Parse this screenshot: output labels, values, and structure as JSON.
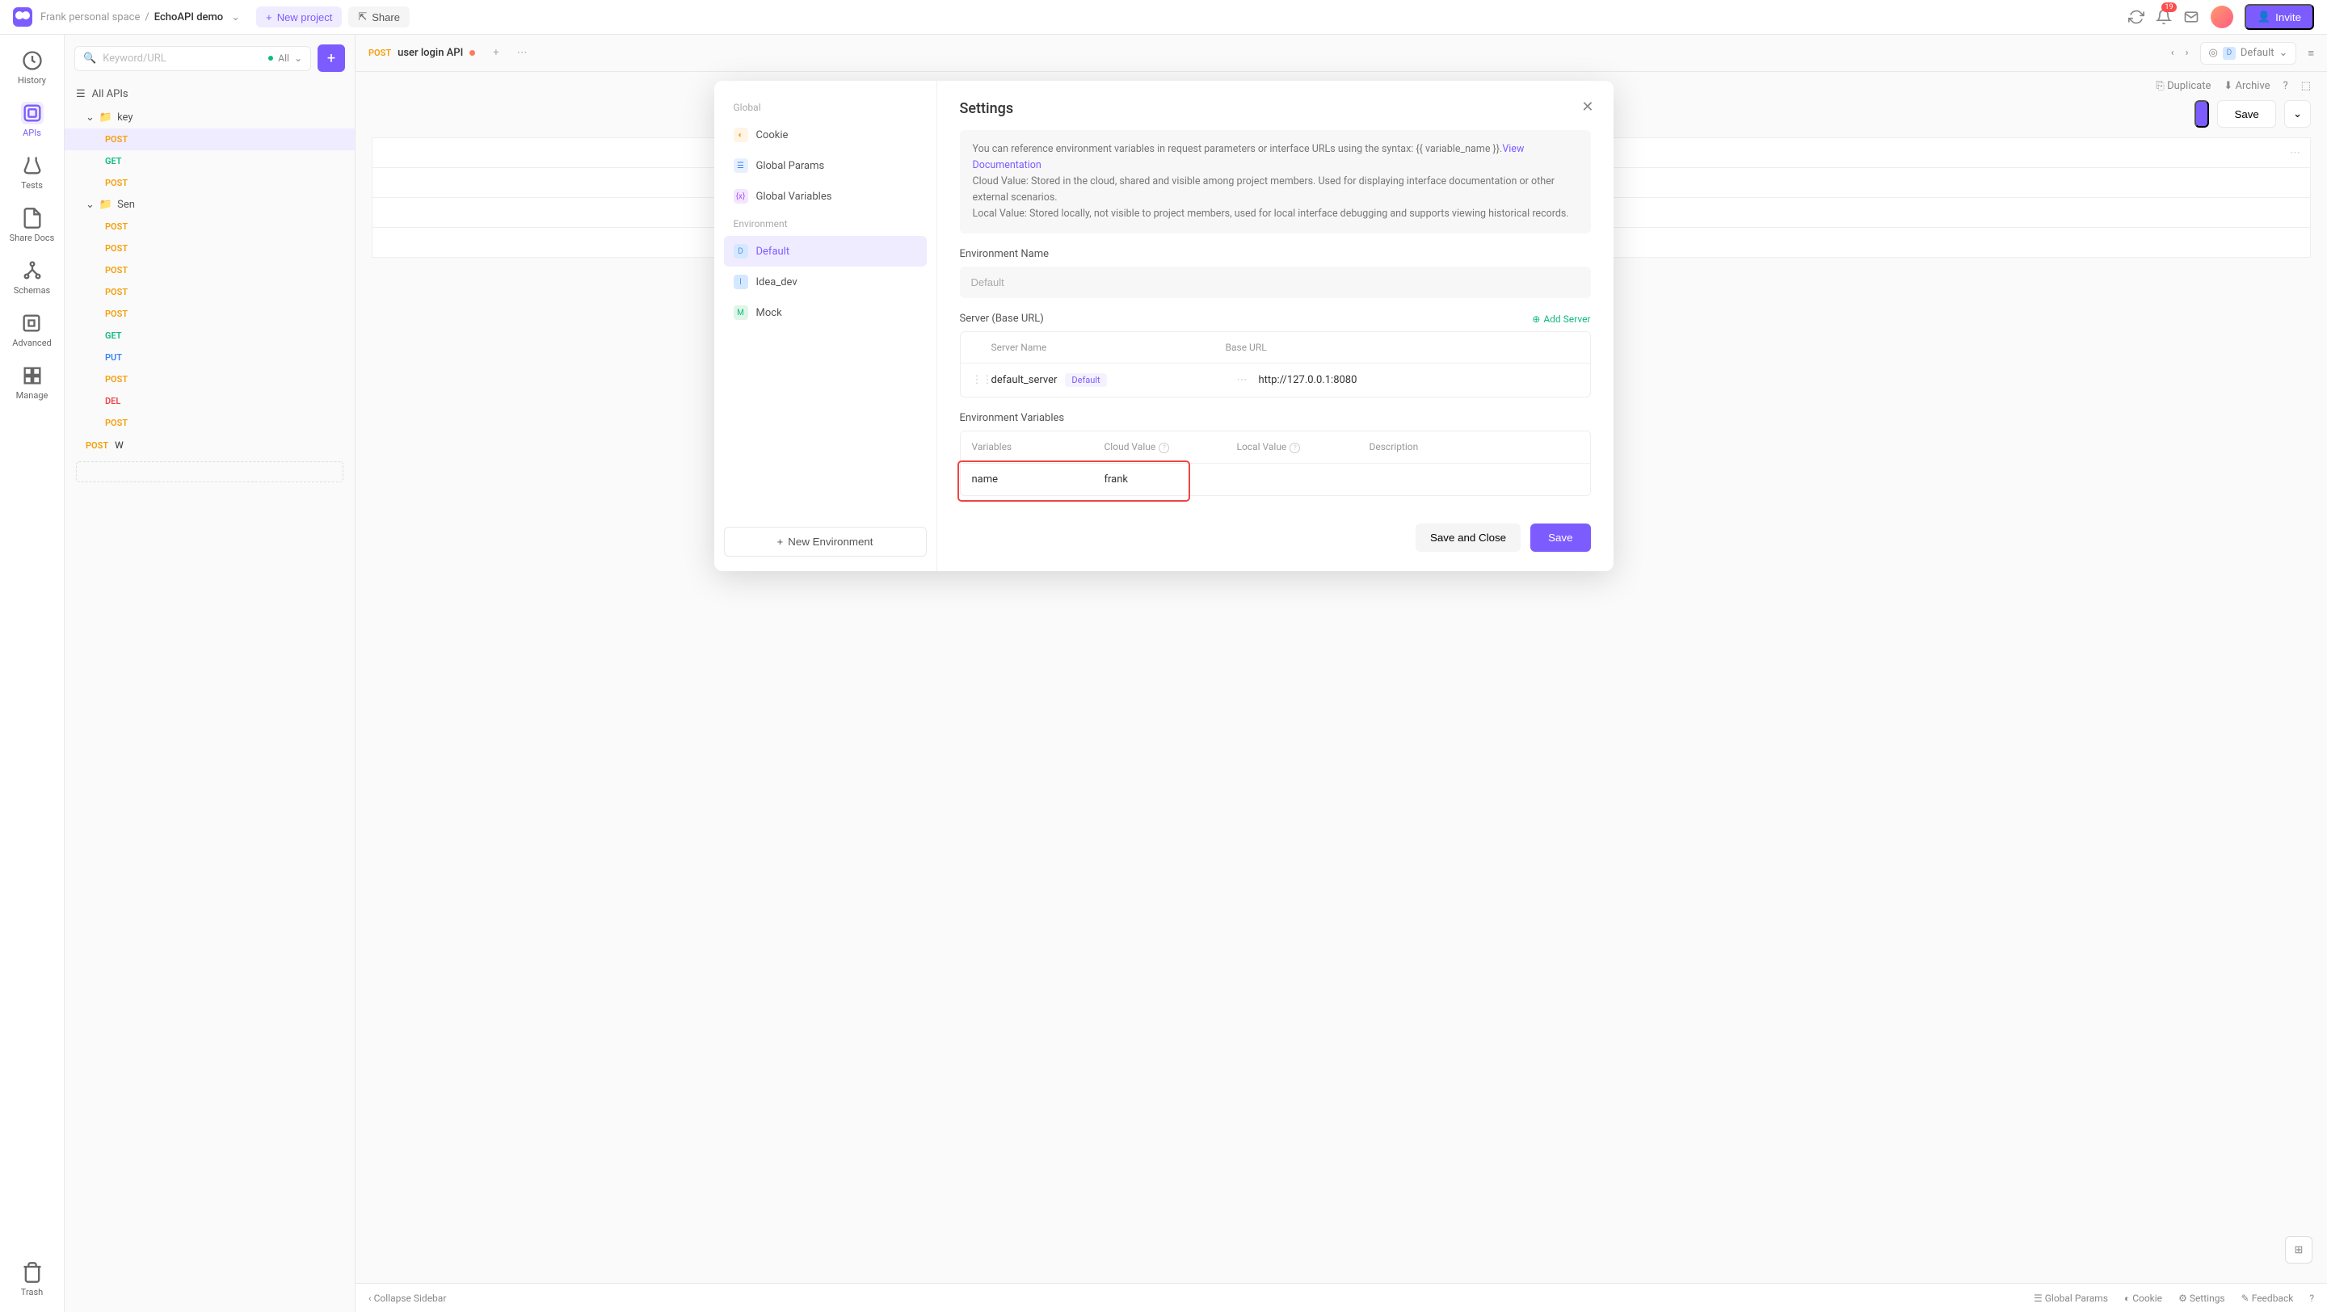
{
  "topbar": {
    "workspace": "Frank personal space",
    "project": "EchoAPI demo",
    "new_project": "New project",
    "share": "Share",
    "notification_count": "19",
    "invite": "Invite"
  },
  "rail": {
    "history": "History",
    "apis": "APIs",
    "tests": "Tests",
    "share_docs": "Share Docs",
    "schemas": "Schemas",
    "advanced": "Advanced",
    "manage": "Manage",
    "trash": "Trash"
  },
  "sidebar": {
    "search_placeholder": "Keyword/URL",
    "filter": "All",
    "all_apis": "All APIs",
    "group1": "key",
    "group2": "Sen",
    "items1": [
      {
        "method": "POST",
        "cls": "m-post"
      },
      {
        "method": "GET",
        "cls": "m-get"
      },
      {
        "method": "POST",
        "cls": "m-post"
      }
    ],
    "items2": [
      {
        "method": "POST",
        "cls": "m-post"
      },
      {
        "method": "POST",
        "cls": "m-post"
      },
      {
        "method": "POST",
        "cls": "m-post"
      },
      {
        "method": "POST",
        "cls": "m-post"
      },
      {
        "method": "POST",
        "cls": "m-post"
      },
      {
        "method": "GET",
        "cls": "m-get"
      },
      {
        "method": "PUT",
        "cls": "m-put"
      },
      {
        "method": "POST",
        "cls": "m-post"
      },
      {
        "method": "DEL",
        "cls": "m-del"
      },
      {
        "method": "POST",
        "cls": "m-post"
      }
    ],
    "last_item": {
      "method": "POST",
      "label": "W",
      "cls": "m-post"
    }
  },
  "tabs": {
    "active": {
      "method": "POST",
      "name": "user login API"
    },
    "env": "Default"
  },
  "pagebar": {
    "duplicate": "Duplicate",
    "archive": "Archive",
    "save": "Save"
  },
  "bottombar": {
    "collapse": "Collapse Sidebar",
    "global_params": "Global Params",
    "cookie": "Cookie",
    "settings": "Settings",
    "feedback": "Feedback"
  },
  "modal": {
    "sections": {
      "global": "Global",
      "environment": "Environment"
    },
    "global_items": {
      "cookie": "Cookie",
      "global_params": "Global Params",
      "global_variables": "Global Variables"
    },
    "env_items": {
      "default": "Default",
      "idea_dev": "Idea_dev",
      "mock": "Mock"
    },
    "new_environment": "New Environment",
    "title": "Settings",
    "info_prefix": "You can reference environment variables in request parameters or interface URLs using the syntax: {{ variable_name }}.",
    "info_link": "View Documentation",
    "info_cloud": "Cloud Value: Stored in the cloud, shared and visible among project members. Used for displaying interface documentation or other external scenarios.",
    "info_local": "Local Value: Stored locally, not visible to project members, used for local interface debugging and supports viewing historical records.",
    "env_name_label": "Environment Name",
    "env_name_value": "Default",
    "server_label": "Server (Base URL)",
    "add_server": "Add Server",
    "server_cols": {
      "name": "Server Name",
      "base": "Base URL"
    },
    "server_row": {
      "name": "default_server",
      "tag": "Default",
      "url": "http://127.0.0.1:8080"
    },
    "vars_label": "Environment Variables",
    "vars_cols": {
      "var": "Variables",
      "cloud": "Cloud Value",
      "local": "Local Value",
      "desc": "Description"
    },
    "vars_row": {
      "name": "name",
      "cloud": "frank"
    },
    "save_close": "Save and Close",
    "save": "Save"
  }
}
